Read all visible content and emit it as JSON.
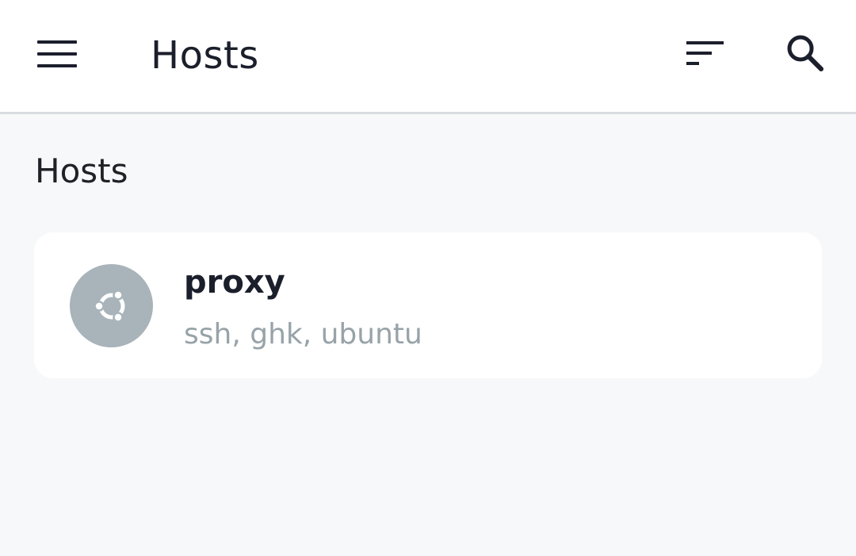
{
  "topbar": {
    "title": "Hosts",
    "menu_icon": "menu-icon",
    "sort_icon": "sort-icon",
    "search_icon": "search-icon"
  },
  "section": {
    "title": "Hosts"
  },
  "hosts": [
    {
      "name": "proxy",
      "tags": "ssh, ghk, ubuntu",
      "os_icon": "ubuntu-icon",
      "avatar_color": "#a8b4ba"
    }
  ],
  "colors": {
    "background": "#f7f8fa",
    "surface": "#ffffff",
    "text_primary": "#1b1e2b",
    "text_secondary": "#97a3a8",
    "divider": "#d9dde1"
  }
}
